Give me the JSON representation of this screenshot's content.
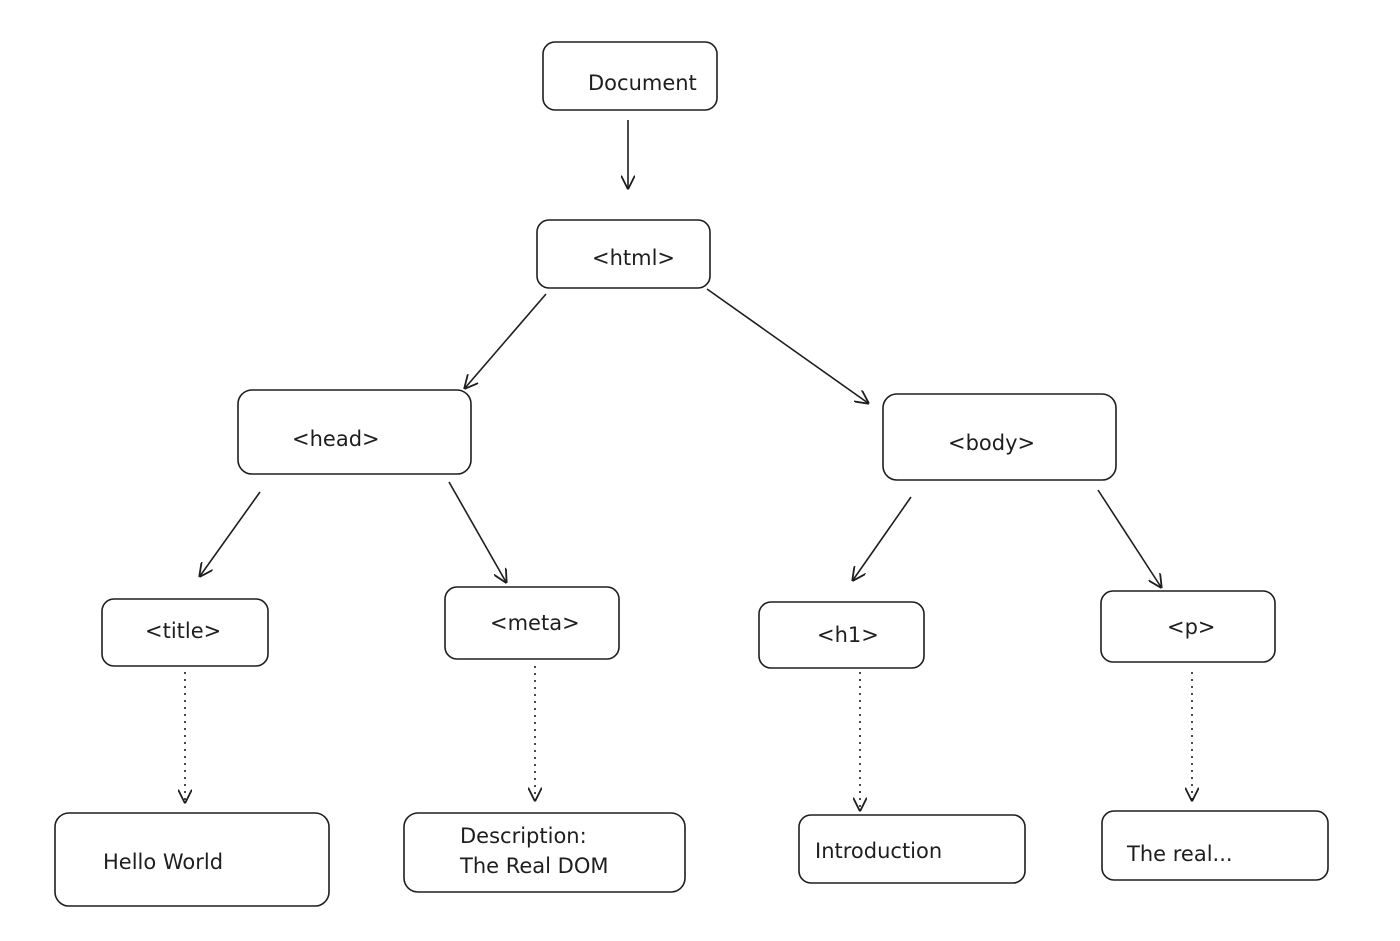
{
  "nodes": {
    "document": {
      "label": "Document"
    },
    "html": {
      "label": "<html>"
    },
    "head": {
      "label": "<head>"
    },
    "body": {
      "label": "<body>"
    },
    "title": {
      "label": "<title>"
    },
    "meta": {
      "label": "<meta>"
    },
    "h1": {
      "label": "<h1>"
    },
    "p": {
      "label": "<p>"
    },
    "title_text": {
      "label": "Hello World"
    },
    "meta_text": {
      "label_line1": "Description:",
      "label_line2": "The Real DOM"
    },
    "h1_text": {
      "label": "Introduction"
    },
    "p_text": {
      "label": "The real..."
    }
  },
  "edges": [
    {
      "from": "document",
      "to": "html",
      "style": "solid"
    },
    {
      "from": "html",
      "to": "head",
      "style": "solid"
    },
    {
      "from": "html",
      "to": "body",
      "style": "solid"
    },
    {
      "from": "head",
      "to": "title",
      "style": "solid"
    },
    {
      "from": "head",
      "to": "meta",
      "style": "solid"
    },
    {
      "from": "body",
      "to": "h1",
      "style": "solid"
    },
    {
      "from": "body",
      "to": "p",
      "style": "solid"
    },
    {
      "from": "title",
      "to": "title_text",
      "style": "dotted"
    },
    {
      "from": "meta",
      "to": "meta_text",
      "style": "dotted"
    },
    {
      "from": "h1",
      "to": "h1_text",
      "style": "dotted"
    },
    {
      "from": "p",
      "to": "p_text",
      "style": "dotted"
    }
  ],
  "colors": {
    "stroke": "#1e1e1e",
    "background": "#ffffff"
  }
}
